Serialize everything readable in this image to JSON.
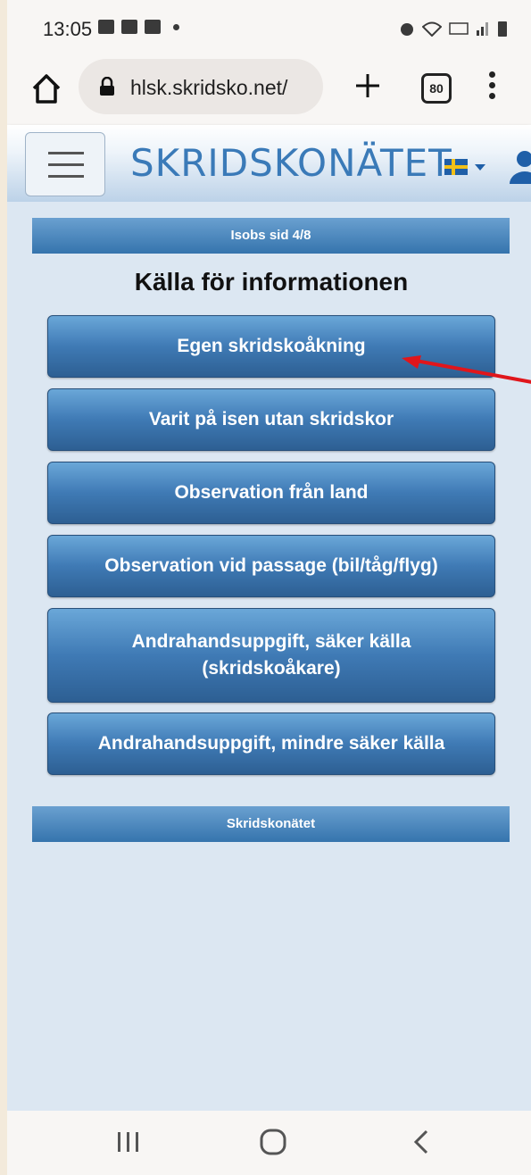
{
  "status_bar": {
    "time": "13:05"
  },
  "browser": {
    "url": "hlsk.skridsko.net/",
    "tab_count": "80"
  },
  "site": {
    "logo_text": "SKRIDSKONÄTET"
  },
  "content": {
    "page_indicator": "Isobs sid 4/8",
    "title": "Källa för informationen",
    "options": [
      {
        "label": "Egen skridskoåkning"
      },
      {
        "label": "Varit på isen utan skridskor"
      },
      {
        "label": "Observation från land"
      },
      {
        "label": "Observation vid passage (bil/tåg/flyg)"
      },
      {
        "label": "Andrahandsuppgift, säker källa (skridskoåkare)"
      },
      {
        "label": "Andrahandsuppgift, mindre säker källa"
      }
    ],
    "footer_band": "Skridskonätet"
  },
  "colors": {
    "accent_arrow": "#e0161b",
    "button_blue": "#3f7ab5",
    "background": "#dce7f2"
  }
}
